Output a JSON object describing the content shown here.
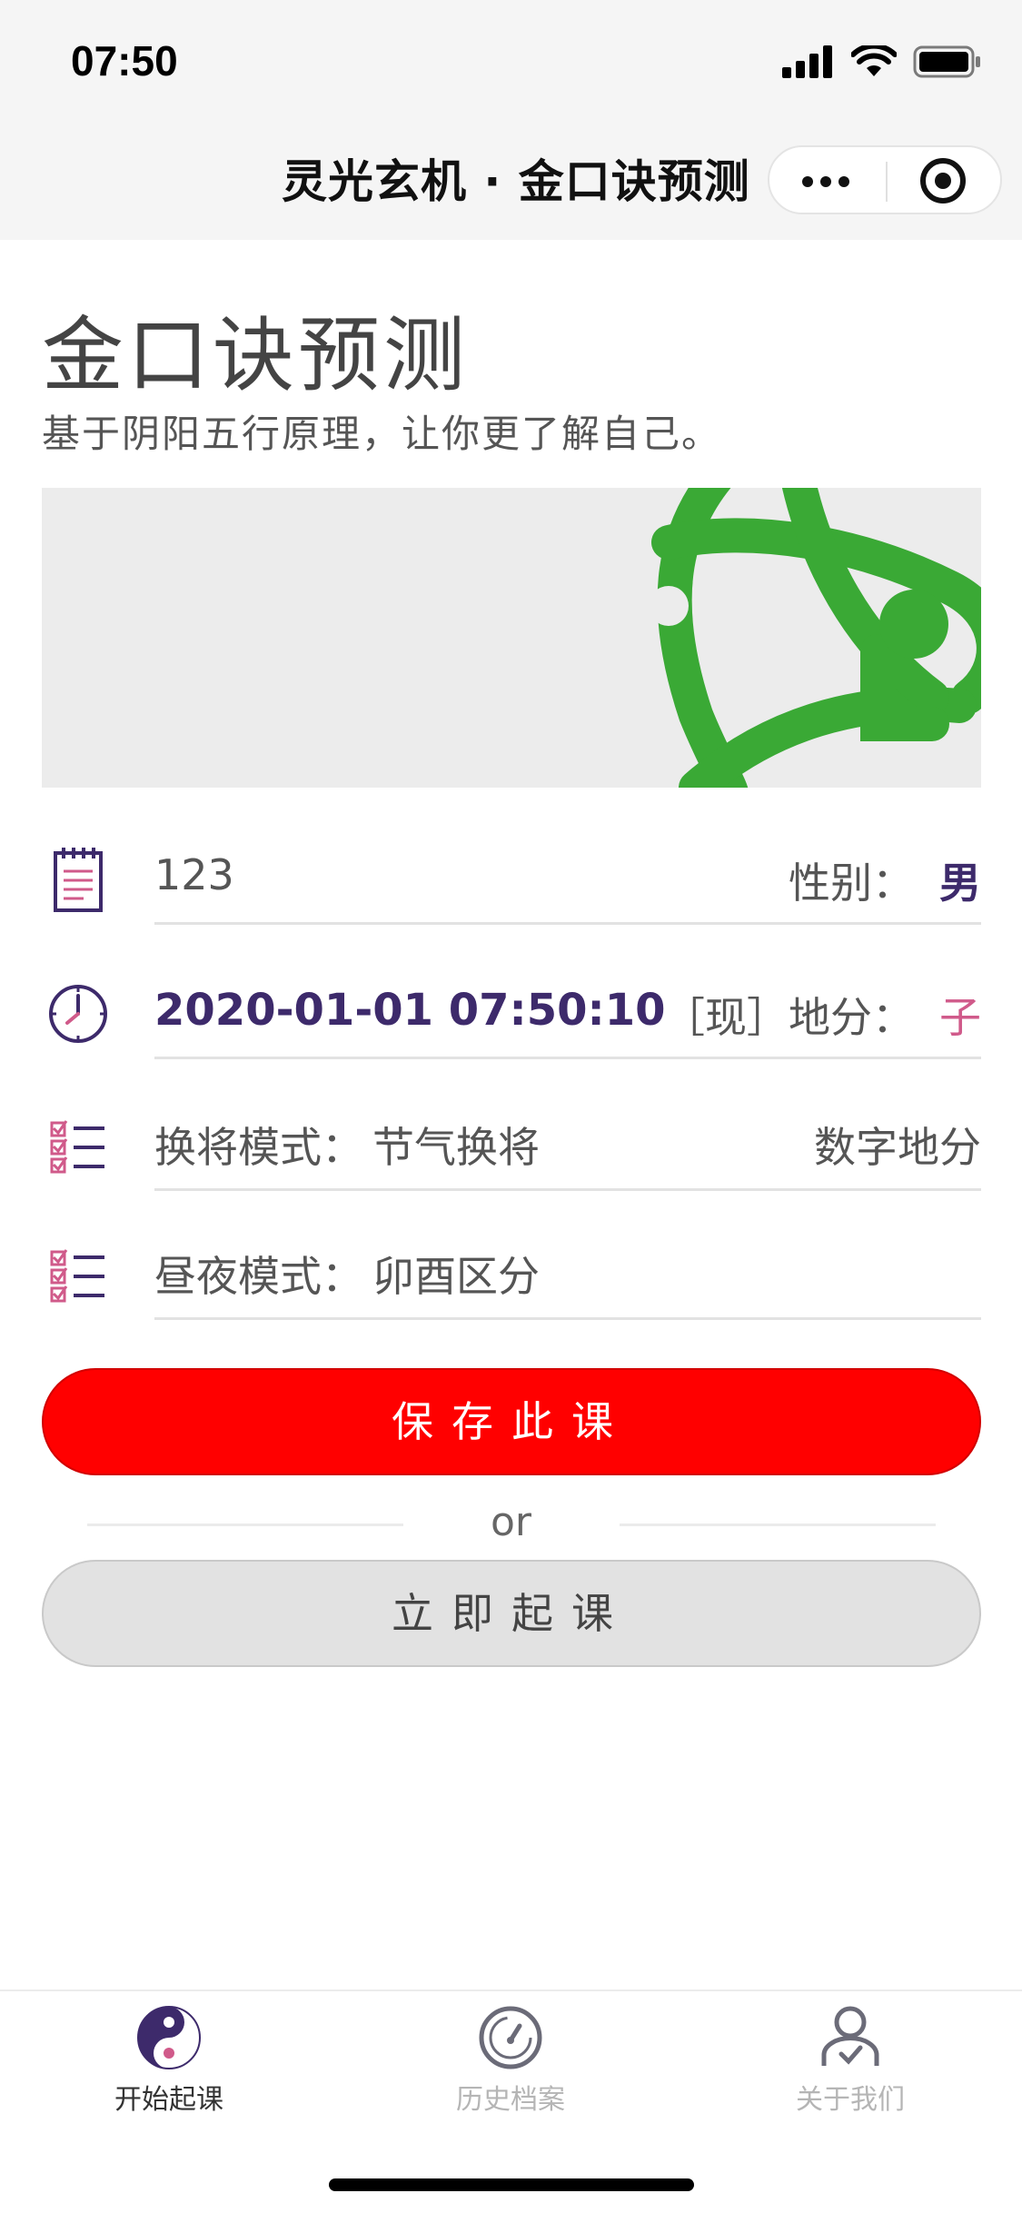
{
  "status_bar": {
    "time": "07:50"
  },
  "nav": {
    "title": "灵光玄机 · 金口诀预测"
  },
  "page": {
    "title": "金口诀预测",
    "subtitle": "基于阴阳五行原理，让你更了解自己。"
  },
  "form": {
    "name_value": "123",
    "gender_label": "性别：",
    "gender_value": "男",
    "datetime_value": "2020-01-01 07:50:10",
    "now_tag": "［现］",
    "difen_label": "地分：",
    "difen_value": "子",
    "huanjiang_label": "换将模式：",
    "huanjiang_value": "节气换将",
    "number_difen": "数字地分",
    "zhouye_label": "昼夜模式：",
    "zhouye_value": "卯酉区分"
  },
  "buttons": {
    "save": "保存此课",
    "or": "or",
    "now": "立即起课"
  },
  "tabbar": {
    "items": [
      {
        "label": "开始起课",
        "icon": "yin-yang-icon",
        "active": true
      },
      {
        "label": "历史档案",
        "icon": "gauge-icon",
        "active": false
      },
      {
        "label": "关于我们",
        "icon": "user-check-icon",
        "active": false
      }
    ]
  },
  "colors": {
    "accent_purple": "#3d2a6b",
    "accent_pink": "#d05a8a",
    "save_red": "#ff0000",
    "logo_green": "#3aa935"
  }
}
